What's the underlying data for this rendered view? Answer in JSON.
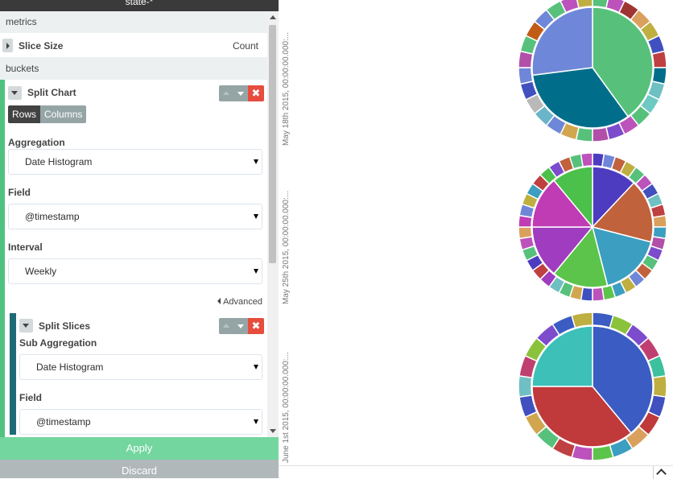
{
  "sidebar": {
    "title": "state-*",
    "metrics_header": "metrics",
    "metric": {
      "title": "Slice Size",
      "value": "Count"
    },
    "buckets_header": "buckets",
    "split_chart": {
      "title": "Split Chart",
      "remove_symbol": "✖",
      "rows_label": "Rows",
      "columns_label": "Columns",
      "aggregation_label": "Aggregation",
      "aggregation_value": "Date Histogram",
      "field_label": "Field",
      "field_value": "@timestamp",
      "interval_label": "Interval",
      "interval_value": "Weekly",
      "advanced_label": "Advanced"
    },
    "split_slices": {
      "title": "Split Slices",
      "remove_symbol": "✖",
      "sub_aggregation_label": "Sub Aggregation",
      "sub_aggregation_value": "Date Histogram",
      "field_label": "Field",
      "field_value": "@timestamp"
    },
    "apply_label": "Apply",
    "discard_label": "Discard"
  },
  "chart_data": {
    "type": "pie",
    "charts": [
      {
        "label": "May 18th 2015, 00:00:00.000:...",
        "inner": [
          {
            "value": 40,
            "color": "#57c17b"
          },
          {
            "value": 33,
            "color": "#006e8a"
          },
          {
            "value": 27,
            "color": "#6f87d8"
          }
        ],
        "outer_colors": [
          "#57c17b",
          "#bc52bc",
          "#9e3533",
          "#daa05d",
          "#bfaf40",
          "#4050bf",
          "#bf4040",
          "#006e8a",
          "#6ec0c3",
          "#6ec9c3",
          "#57c17b",
          "#bc52bc",
          "#7c4ccd",
          "#b14fa9",
          "#57c17b",
          "#d1a64f",
          "#6f87d8",
          "#6ab5c8",
          "#b9b9b9",
          "#4050bf",
          "#6f87d8",
          "#b14fa9",
          "#57c17b",
          "#c15c17",
          "#6f87d8",
          "#57c17b",
          "#bc52bc",
          "#bfaf40"
        ]
      },
      {
        "label": "May 25th 2015, 00:00:00.000:...",
        "inner": [
          {
            "value": 12,
            "color": "#4d3cc0"
          },
          {
            "value": 17,
            "color": "#c0623c"
          },
          {
            "value": 17,
            "color": "#3c9ec0"
          },
          {
            "value": 15,
            "color": "#5cc44a"
          },
          {
            "value": 14,
            "color": "#a03cc0"
          },
          {
            "value": 14,
            "color": "#c03cb4"
          },
          {
            "value": 11,
            "color": "#4bc04b"
          }
        ],
        "outer_colors": [
          "#4d3cc0",
          "#6f87d8",
          "#c0623c",
          "#bfaf40",
          "#57c17b",
          "#bc52bc",
          "#4050bf",
          "#6ec0c3",
          "#bf4040",
          "#daa05d",
          "#3c9ec0",
          "#b14fa9",
          "#7c4ccd",
          "#57c17b",
          "#c0623c",
          "#6f87d8",
          "#bfaf40",
          "#3c9ec0",
          "#5cc44a",
          "#bc52bc",
          "#4050bf",
          "#d1a64f",
          "#57c17b",
          "#6ec0c3",
          "#a03cc0",
          "#bf4040",
          "#4d3cc0",
          "#57c17b",
          "#bc52bc",
          "#daa05d",
          "#c03cb4",
          "#6f87d8",
          "#bfaf40",
          "#3c9ec0",
          "#bf4040",
          "#4bc04b",
          "#7c4ccd",
          "#c0623c",
          "#57c17b",
          "#bc52bc"
        ]
      },
      {
        "label": "June 1st 2015, 00:00:00.000:...",
        "inner": [
          {
            "value": 39,
            "color": "#3b5cc2"
          },
          {
            "value": 36,
            "color": "#c0393b"
          },
          {
            "value": 25,
            "color": "#3cc0b8"
          }
        ],
        "outer_colors": [
          "#3b5cc2",
          "#8ac23b",
          "#7c4ccd",
          "#bf4070",
          "#3cc09e",
          "#bfaf40",
          "#4050bf",
          "#c0393b",
          "#daa05d",
          "#3c9ec0",
          "#5cc44a",
          "#bc52bc",
          "#bf4040",
          "#57c17b",
          "#d1a64f",
          "#4050bf",
          "#6ec0c3",
          "#bf4070",
          "#8ac23b",
          "#7c4ccd",
          "#3b5cc2",
          "#bfaf40"
        ]
      }
    ]
  }
}
